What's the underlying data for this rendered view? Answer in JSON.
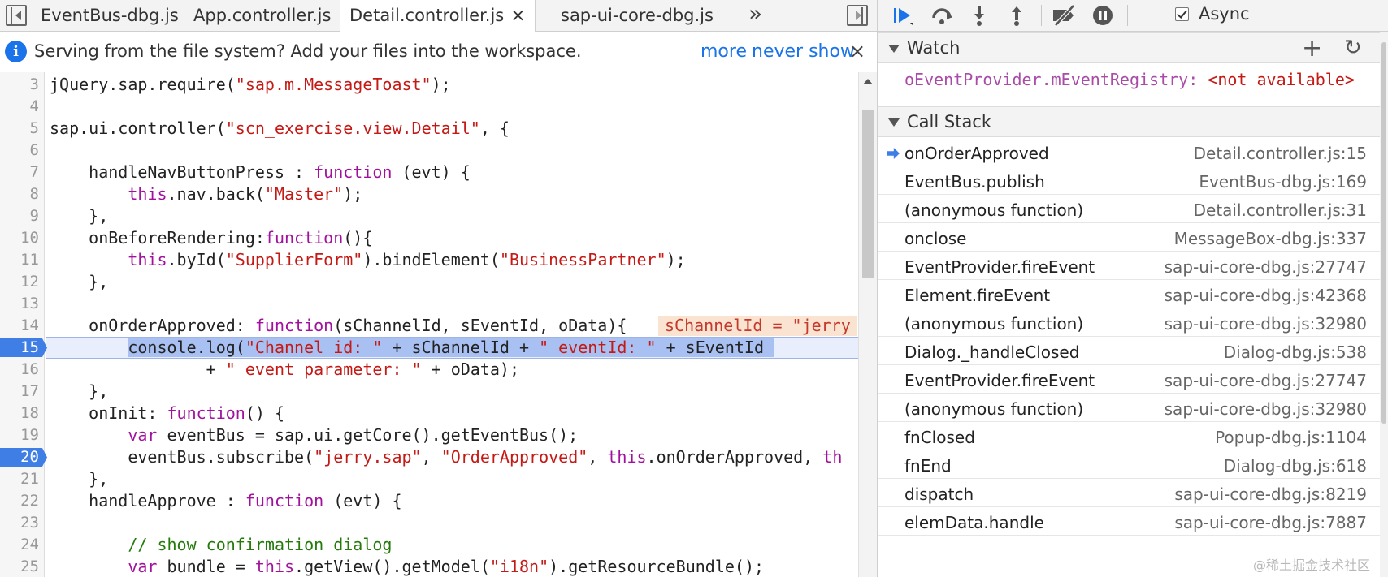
{
  "tabs": [
    {
      "label": "EventBus-dbg.js",
      "active": false
    },
    {
      "label": "App.controller.js",
      "active": false
    },
    {
      "label": "Detail.controller.js",
      "active": true,
      "closable": true
    },
    {
      "label": "sap-ui-core-dbg.js",
      "active": false
    }
  ],
  "tab_overflow": "»",
  "tab_close": "×",
  "infobar": {
    "message": "Serving from the file system? Add your files into the workspace.",
    "more_label": "more",
    "never_show_label": "never show",
    "close": "×",
    "icon": "i"
  },
  "editor": {
    "lines": [
      {
        "n": "3",
        "segments": [
          {
            "t": "jQuery.sap.require("
          },
          {
            "t": "\"sap.m.MessageToast\"",
            "c": "st"
          },
          {
            "t": ");"
          }
        ]
      },
      {
        "n": "4",
        "segments": []
      },
      {
        "n": "5",
        "segments": [
          {
            "t": "sap.ui.controller("
          },
          {
            "t": "\"scn_exercise.view.Detail\"",
            "c": "st"
          },
          {
            "t": ", {"
          }
        ]
      },
      {
        "n": "6",
        "segments": []
      },
      {
        "n": "7",
        "segments": [
          {
            "t": "    handleNavButtonPress : "
          },
          {
            "t": "function",
            "c": "kw"
          },
          {
            "t": " (evt) {"
          }
        ]
      },
      {
        "n": "8",
        "segments": [
          {
            "t": "        "
          },
          {
            "t": "this",
            "c": "kw"
          },
          {
            "t": ".nav.back("
          },
          {
            "t": "\"Master\"",
            "c": "st"
          },
          {
            "t": ");"
          }
        ]
      },
      {
        "n": "9",
        "segments": [
          {
            "t": "    },"
          }
        ]
      },
      {
        "n": "10",
        "segments": [
          {
            "t": "    onBeforeRendering:"
          },
          {
            "t": "function",
            "c": "kw"
          },
          {
            "t": "(){"
          }
        ]
      },
      {
        "n": "11",
        "segments": [
          {
            "t": "        "
          },
          {
            "t": "this",
            "c": "kw"
          },
          {
            "t": ".byId("
          },
          {
            "t": "\"SupplierForm\"",
            "c": "st"
          },
          {
            "t": ").bindElement("
          },
          {
            "t": "\"BusinessPartner\"",
            "c": "st"
          },
          {
            "t": ");"
          }
        ]
      },
      {
        "n": "12",
        "segments": [
          {
            "t": "    },"
          }
        ]
      },
      {
        "n": "13",
        "segments": []
      },
      {
        "n": "14",
        "segments": [
          {
            "t": "    onOrderApproved: "
          },
          {
            "t": "function",
            "c": "kw"
          },
          {
            "t": "(sChannelId, sEventId, oData){"
          }
        ],
        "inline": "sChannelId = \"jerry"
      },
      {
        "n": "15",
        "breakpoint": true,
        "exec": true,
        "segments": [
          {
            "t": "        "
          },
          {
            "t": "console.log(",
            "sel": true
          },
          {
            "t": "\"Channel id: \"",
            "c": "st",
            "sel": true
          },
          {
            "t": " + sChannelId + ",
            "sel": true
          },
          {
            "t": "\" eventId: \"",
            "c": "st",
            "sel": true
          },
          {
            "t": " + sEventId ",
            "sel": true
          }
        ]
      },
      {
        "n": "16",
        "segments": [
          {
            "t": "                + "
          },
          {
            "t": "\" event parameter: \"",
            "c": "st"
          },
          {
            "t": " + oData);"
          }
        ]
      },
      {
        "n": "17",
        "segments": [
          {
            "t": "    },"
          }
        ]
      },
      {
        "n": "18",
        "segments": [
          {
            "t": "    onInit: "
          },
          {
            "t": "function",
            "c": "kw"
          },
          {
            "t": "() {"
          }
        ]
      },
      {
        "n": "19",
        "segments": [
          {
            "t": "        "
          },
          {
            "t": "var",
            "c": "kw"
          },
          {
            "t": " eventBus = sap.ui.getCore().getEventBus();"
          }
        ]
      },
      {
        "n": "20",
        "breakpoint": true,
        "segments": [
          {
            "t": "        eventBus.subscribe("
          },
          {
            "t": "\"jerry.sap\"",
            "c": "st"
          },
          {
            "t": ", "
          },
          {
            "t": "\"OrderApproved\"",
            "c": "st"
          },
          {
            "t": ", "
          },
          {
            "t": "this",
            "c": "kw"
          },
          {
            "t": ".onOrderApproved, "
          },
          {
            "t": "th",
            "c": "kw"
          }
        ]
      },
      {
        "n": "21",
        "segments": [
          {
            "t": "    },"
          }
        ]
      },
      {
        "n": "22",
        "segments": [
          {
            "t": "    handleApprove : "
          },
          {
            "t": "function",
            "c": "kw"
          },
          {
            "t": " (evt) {"
          }
        ]
      },
      {
        "n": "23",
        "segments": []
      },
      {
        "n": "24",
        "segments": [
          {
            "t": "        "
          },
          {
            "t": "// show confirmation dialog",
            "c": "cm"
          }
        ]
      },
      {
        "n": "25",
        "segments": [
          {
            "t": "        "
          },
          {
            "t": "var",
            "c": "kw"
          },
          {
            "t": " bundle = "
          },
          {
            "t": "this",
            "c": "kw"
          },
          {
            "t": ".getView().getModel("
          },
          {
            "t": "\"i18n\"",
            "c": "st"
          },
          {
            "t": ").getResourceBundle();"
          }
        ]
      }
    ]
  },
  "debugger": {
    "async_label": "Async",
    "async_checked": true,
    "icons": [
      "resume-icon",
      "step-over-icon",
      "step-into-icon",
      "step-out-icon",
      "deactivate-breakpoints-icon",
      "pause-on-exceptions-icon"
    ]
  },
  "watch": {
    "title": "Watch",
    "add": "+",
    "refresh": "↻",
    "expression": "oEventProvider.mEventRegistry:",
    "value": "<not available>"
  },
  "call_stack": {
    "title": "Call Stack",
    "frames": [
      {
        "name": "onOrderApproved",
        "location": "Detail.controller.js:15",
        "current": true
      },
      {
        "name": "EventBus.publish",
        "location": "EventBus-dbg.js:169"
      },
      {
        "name": "(anonymous function)",
        "location": "Detail.controller.js:31"
      },
      {
        "name": "onclose",
        "location": "MessageBox-dbg.js:337"
      },
      {
        "name": "EventProvider.fireEvent",
        "location": "sap-ui-core-dbg.js:27747"
      },
      {
        "name": "Element.fireEvent",
        "location": "sap-ui-core-dbg.js:42368"
      },
      {
        "name": "(anonymous function)",
        "location": "sap-ui-core-dbg.js:32980"
      },
      {
        "name": "Dialog._handleClosed",
        "location": "Dialog-dbg.js:538"
      },
      {
        "name": "EventProvider.fireEvent",
        "location": "sap-ui-core-dbg.js:27747"
      },
      {
        "name": "(anonymous function)",
        "location": "sap-ui-core-dbg.js:32980"
      },
      {
        "name": "fnClosed",
        "location": "Popup-dbg.js:1104"
      },
      {
        "name": "fnEnd",
        "location": "Dialog-dbg.js:618"
      },
      {
        "name": "dispatch",
        "location": "sap-ui-core-dbg.js:8219"
      },
      {
        "name": "elemData.handle",
        "location": "sap-ui-core-dbg.js:7887"
      }
    ]
  },
  "watermark": "@稀土掘金技术社区"
}
